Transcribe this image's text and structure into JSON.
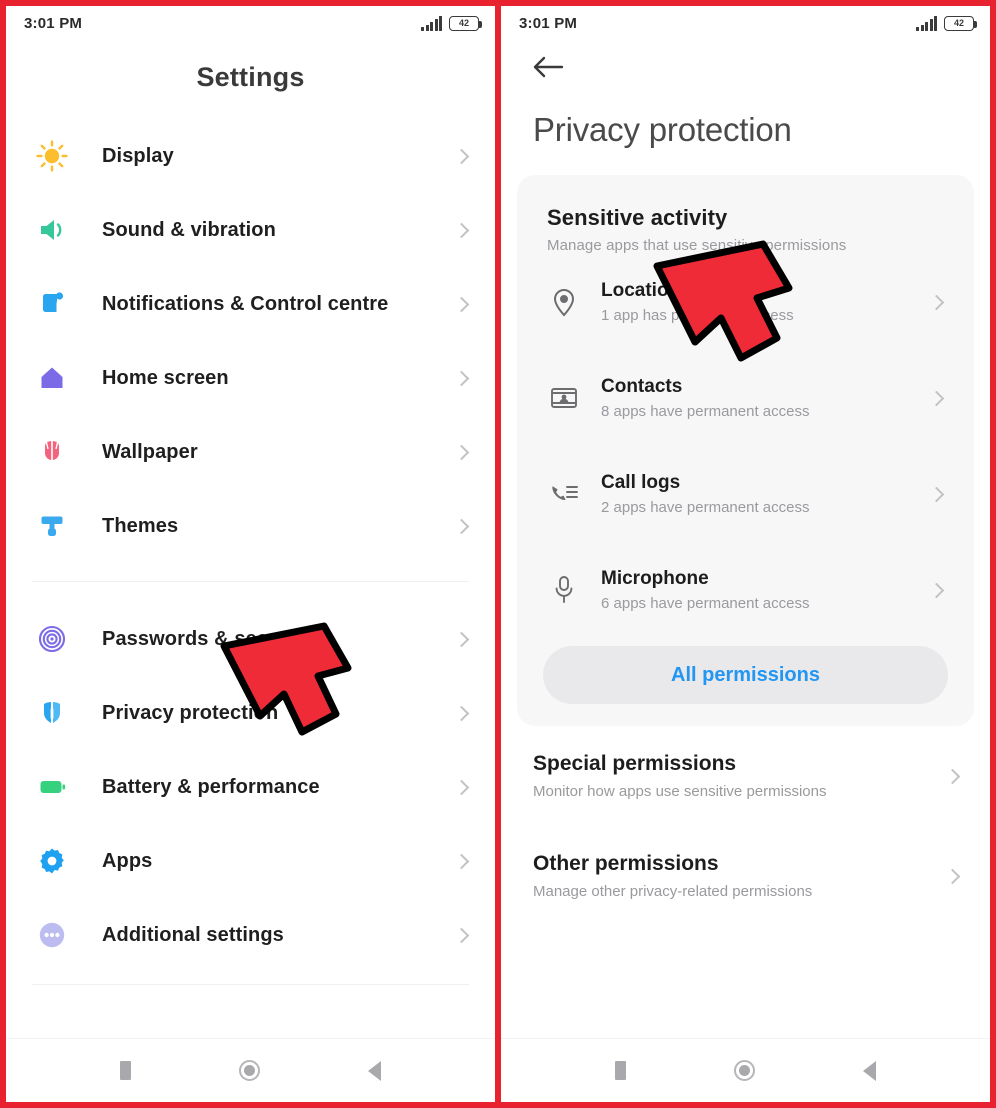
{
  "status_bar": {
    "time": "3:01 PM",
    "battery_level": "42",
    "signal_icon": "signal-bars-icon",
    "battery_icon": "battery-icon"
  },
  "left_panel": {
    "title": "Settings",
    "groups": [
      {
        "items": [
          {
            "label": "Display",
            "icon": "sun-icon",
            "color": "#FBBE2C"
          },
          {
            "label": "Sound & vibration",
            "icon": "speaker-icon",
            "color": "#36C79B"
          },
          {
            "label": "Notifications & Control centre",
            "icon": "notification-card-icon",
            "color": "#2AA5F0"
          },
          {
            "label": "Home screen",
            "icon": "home-icon",
            "color": "#7B6BE6"
          },
          {
            "label": "Wallpaper",
            "icon": "tulip-icon",
            "color": "#F4637E"
          },
          {
            "label": "Themes",
            "icon": "paint-roller-icon",
            "color": "#3BA9EE"
          }
        ]
      },
      {
        "items": [
          {
            "label": "Passwords & security",
            "icon": "fingerprint-icon",
            "color": "#7B6BE6"
          },
          {
            "label": "Privacy protection",
            "icon": "shield-icon",
            "color": "#2AA5F0"
          },
          {
            "label": "Battery & performance",
            "icon": "battery-full-icon",
            "color": "#36D17F"
          },
          {
            "label": "Apps",
            "icon": "gear-icon",
            "color": "#1EA1F1"
          },
          {
            "label": "Additional settings",
            "icon": "ellipsis-icon",
            "color": "#A7A6E8"
          }
        ]
      }
    ]
  },
  "right_panel": {
    "back_icon": "back-arrow-icon",
    "title": "Privacy protection",
    "card": {
      "heading": "Sensitive activity",
      "subheading": "Manage apps that use sensitive permissions",
      "permissions": [
        {
          "name": "Location",
          "detail": "1 app has permanent access",
          "icon": "location-pin-icon"
        },
        {
          "name": "Contacts",
          "detail": "8 apps have permanent access",
          "icon": "contact-card-icon"
        },
        {
          "name": "Call logs",
          "detail": "2 apps have permanent access",
          "icon": "call-log-icon"
        },
        {
          "name": "Microphone",
          "detail": "6 apps have permanent access",
          "icon": "microphone-icon"
        }
      ],
      "all_permissions_label": "All permissions",
      "all_permissions_color": "#2196f3"
    },
    "sections": [
      {
        "title": "Special permissions",
        "subtitle": "Monitor how apps use sensitive permissions"
      },
      {
        "title": "Other permissions",
        "subtitle": "Manage other privacy-related permissions"
      }
    ]
  },
  "nav_bar": {
    "recents_icon": "recents-square-icon",
    "home_icon": "home-circle-icon",
    "back_icon": "back-triangle-icon"
  },
  "annotations": {
    "arrow_color": "#EE2B36",
    "arrow_outline": "#000000",
    "count": 2
  }
}
